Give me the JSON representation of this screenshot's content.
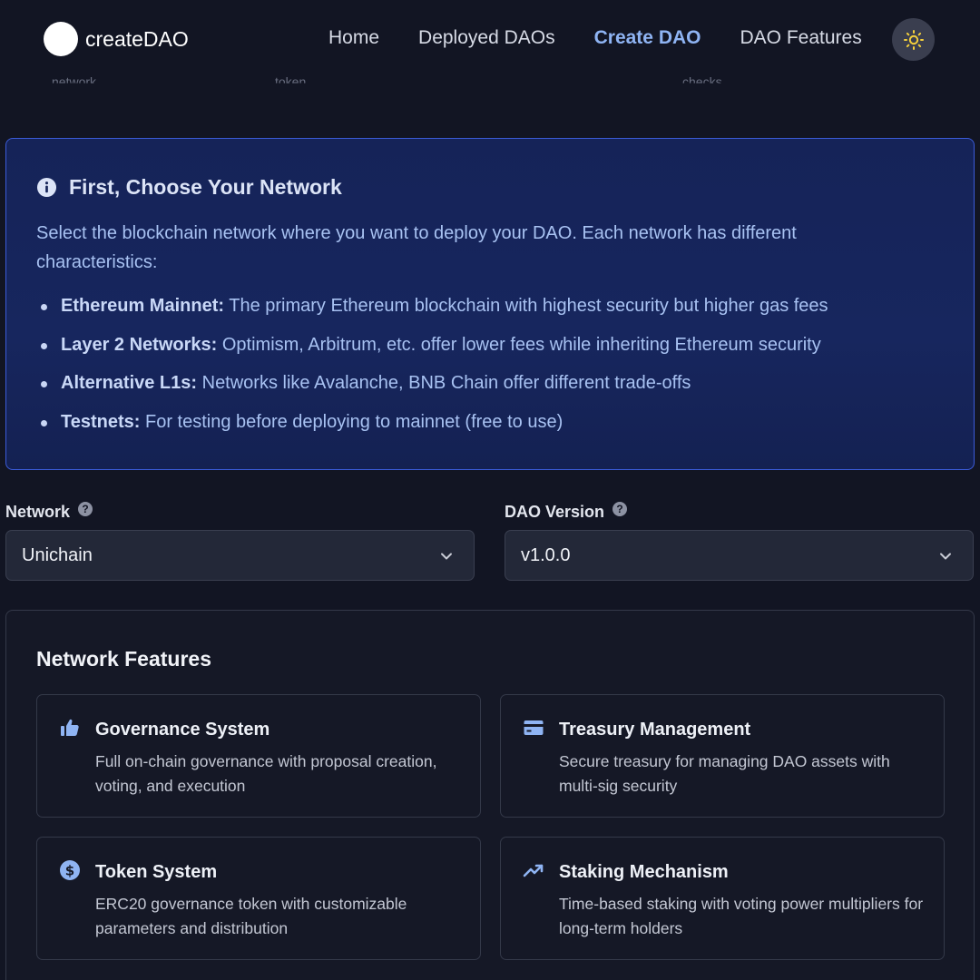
{
  "header": {
    "logo_text": "createDAO",
    "nav": [
      {
        "label": "Home",
        "active": false
      },
      {
        "label": "Deployed DAOs",
        "active": false
      },
      {
        "label": "Create DAO",
        "active": true
      },
      {
        "label": "DAO Features",
        "active": false
      }
    ],
    "theme_icon": "sun-icon"
  },
  "stepper": {
    "labels": [
      "network",
      "token",
      "checks"
    ]
  },
  "info": {
    "icon": "info-icon",
    "title": "First, Choose Your Network",
    "description": "Select the blockchain network where you want to deploy your DAO. Each network has different characteristics:",
    "items": [
      {
        "term": "Ethereum Mainnet:",
        "text": " The primary Ethereum blockchain with highest security but higher gas fees"
      },
      {
        "term": "Layer 2 Networks:",
        "text": " Optimism, Arbitrum, etc. offer lower fees while inheriting Ethereum security"
      },
      {
        "term": "Alternative L1s:",
        "text": " Networks like Avalanche, BNB Chain offer different trade-offs"
      },
      {
        "term": "Testnets:",
        "text": " For testing before deploying to mainnet (free to use)"
      }
    ]
  },
  "network_field": {
    "label": "Network",
    "value": "Unichain"
  },
  "version_field": {
    "label": "DAO Version",
    "value": "v1.0.0"
  },
  "features": {
    "title": "Network Features",
    "items": [
      {
        "icon": "thumbs-up-icon",
        "title": "Governance System",
        "desc": "Full on-chain governance with proposal creation, voting, and execution"
      },
      {
        "icon": "credit-card-icon",
        "title": "Treasury Management",
        "desc": "Secure treasury for managing DAO assets with multi-sig security"
      },
      {
        "icon": "dollar-coin-icon",
        "title": "Token System",
        "desc": "ERC20 governance token with customizable parameters and distribution"
      },
      {
        "icon": "trending-up-icon",
        "title": "Staking Mechanism",
        "desc": "Time-based staking with voting power multipliers for long-term holders"
      }
    ]
  },
  "colors": {
    "background": "#121523",
    "accent": "#8fb4f3",
    "info_border": "#3b5bd8",
    "info_text": "#a8c2f2"
  }
}
